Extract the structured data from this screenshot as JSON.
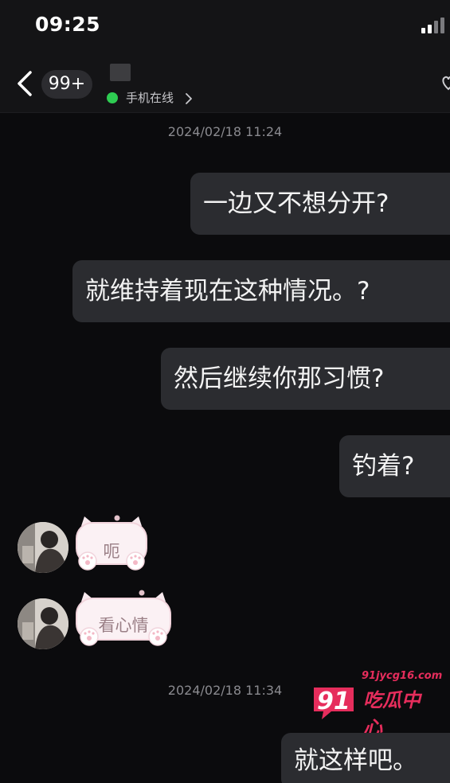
{
  "status_bar": {
    "time": "09:25"
  },
  "header": {
    "unread_count": "99+",
    "online_status": "手机在线"
  },
  "timestamps": [
    "2024/02/18 11:24",
    "2024/02/18 11:34"
  ],
  "messages": [
    {
      "side": "out",
      "text": "一边又不想分开?"
    },
    {
      "side": "out",
      "text": "就维持着现在这种情况。?"
    },
    {
      "side": "out",
      "text": "然后继续你那习惯?"
    },
    {
      "side": "out",
      "text": "钓着?"
    },
    {
      "side": "in",
      "sticker_text": "呃"
    },
    {
      "side": "in",
      "sticker_text": "看心情"
    },
    {
      "side": "out",
      "text": "就这样吧。"
    }
  ],
  "watermark": {
    "url": "91jycg16.com",
    "logo": "91",
    "brand": "吃瓜中心"
  },
  "colors": {
    "background": "#0b0b0d",
    "bubble_out": "#2b2c30",
    "online": "#2ecc52",
    "watermark": "#e62d5c"
  },
  "icons": [
    "signal-icon",
    "back-icon",
    "chevron-right-icon",
    "heart-icon"
  ]
}
